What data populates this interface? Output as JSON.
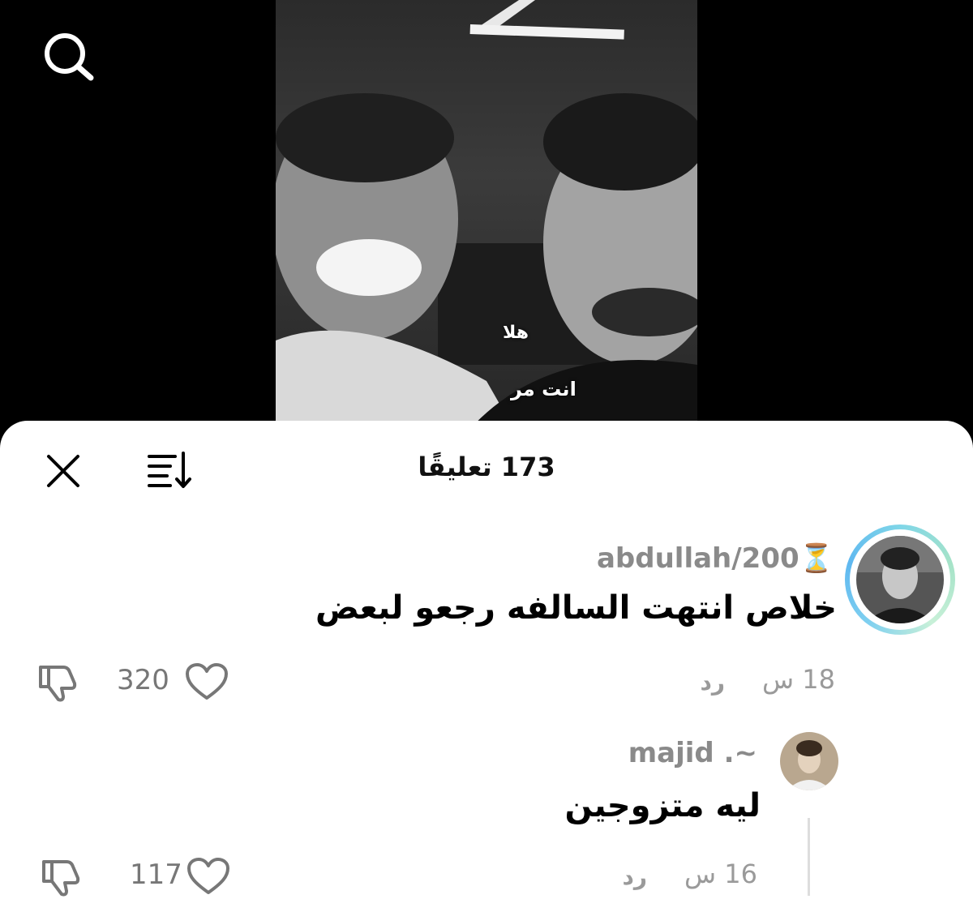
{
  "video": {
    "caption_top": "هلا",
    "caption_bottom": "انت مر"
  },
  "sheet": {
    "title": "173 تعليقًا"
  },
  "comments": [
    {
      "username": "abdullah/200⏳",
      "text": "خلاص انتهت السالفه رجعو لبعض",
      "time": "18 س",
      "reply_label": "رد",
      "likes": "320"
    },
    {
      "username": "majid .~",
      "text": "ليه متزوجين",
      "time": "16 س",
      "reply_label": "رد",
      "likes": "117"
    }
  ],
  "icons": {
    "search": "search-icon",
    "close": "close-icon",
    "sort": "sort-icon",
    "heart": "heart-icon",
    "dislike": "thumbs-down-icon"
  }
}
